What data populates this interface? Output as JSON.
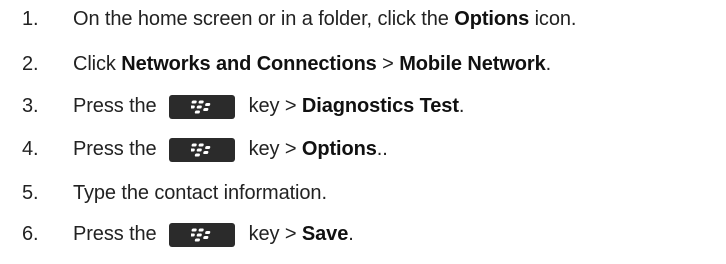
{
  "steps": [
    {
      "number": "1.",
      "parts": [
        "On the home screen or in a folder, click the ",
        "Options",
        " icon."
      ]
    },
    {
      "number": "2.",
      "parts": [
        "Click ",
        "Networks and Connections",
        " > ",
        "Mobile Network",
        "."
      ]
    },
    {
      "number": "3.",
      "parts": [
        "Press the",
        "key > ",
        "Diagnostics Test",
        "."
      ]
    },
    {
      "number": "4.",
      "parts": [
        "Press the",
        "key > ",
        "Options",
        ".."
      ]
    },
    {
      "number": "5.",
      "parts": [
        "Type the contact information."
      ]
    },
    {
      "number": "6.",
      "parts": [
        "Press the",
        "key > ",
        "Save",
        "."
      ]
    }
  ],
  "icons": {
    "menu_key": "blackberry-menu-key-icon"
  },
  "colors": {
    "text": "#222222",
    "key_background": "#2b2b2b",
    "key_glyph": "#ffffff"
  }
}
